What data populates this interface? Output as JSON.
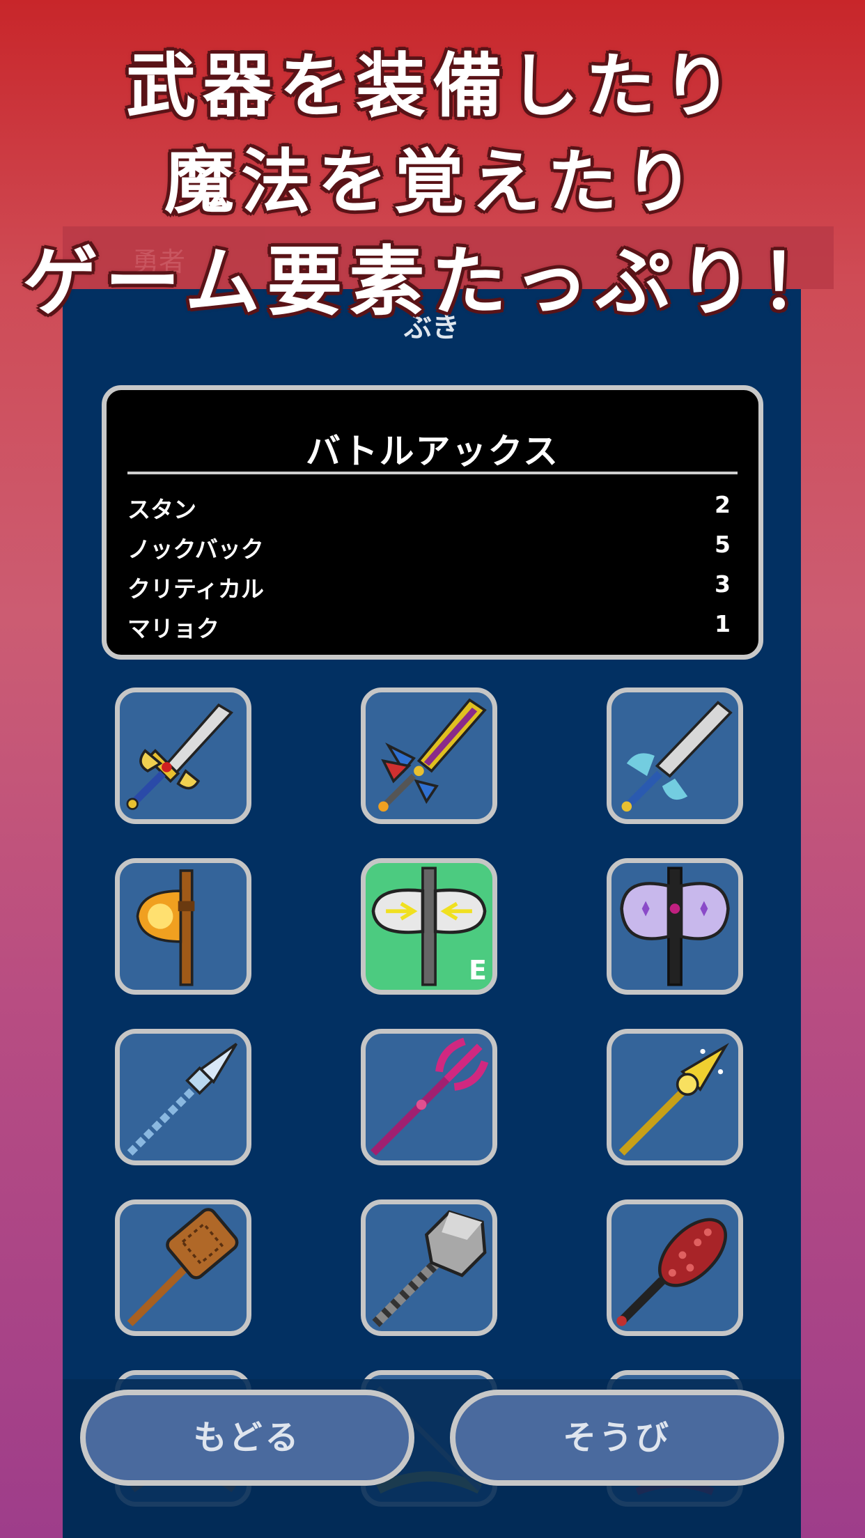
{
  "headline": {
    "line1": "武器を装備したり",
    "line2": "魔法を覚えたり",
    "line3": "ゲーム要素たっぷり！"
  },
  "screen": {
    "title": "ぶき",
    "status_ghost": "勇者"
  },
  "weapon": {
    "name": "バトルアックス",
    "stats": [
      {
        "label": "スタン",
        "value": "2"
      },
      {
        "label": "ノックバック",
        "value": "5"
      },
      {
        "label": "クリティカル",
        "value": "3"
      },
      {
        "label": "マリョク",
        "value": "1"
      }
    ]
  },
  "grid": [
    {
      "icon": "winged-sword-icon"
    },
    {
      "icon": "jeweled-greatsword-icon"
    },
    {
      "icon": "ice-sword-icon"
    },
    {
      "icon": "fire-axe-icon"
    },
    {
      "icon": "battle-axe-icon",
      "selected": true,
      "badge": "E"
    },
    {
      "icon": "crystal-axe-icon"
    },
    {
      "icon": "ice-spear-icon"
    },
    {
      "icon": "trident-icon"
    },
    {
      "icon": "golden-spear-icon"
    },
    {
      "icon": "wooden-hammer-icon"
    },
    {
      "icon": "iron-mace-icon"
    },
    {
      "icon": "spiked-club-icon"
    }
  ],
  "buttons": {
    "back": "もどる",
    "equip": "そうび"
  },
  "colors": {
    "panel_bg": "#023062",
    "cell_bg": "#34649a",
    "cell_selected": "#4ccb80",
    "button_bg": "#4a6a9e"
  }
}
